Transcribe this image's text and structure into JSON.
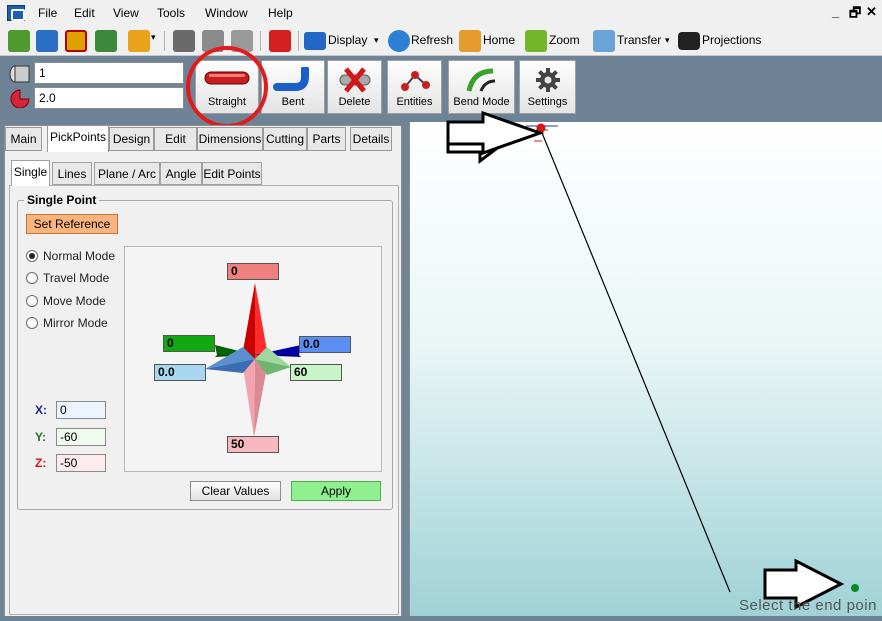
{
  "menu": {
    "items": [
      "File",
      "Edit",
      "View",
      "Tools",
      "Window",
      "Help"
    ],
    "controls": [
      "_",
      "🗗",
      "✕"
    ]
  },
  "toolbar": {
    "display": "Display",
    "refresh": "Refresh",
    "home": "Home",
    "zoom": "Zoom",
    "transfer": "Transfer",
    "projections": "Projections"
  },
  "ribbon": {
    "field1": "1",
    "field2": "2.0",
    "buttons": [
      "Straight",
      "Bent",
      "Delete",
      "Entities",
      "Bend Mode",
      "Settings"
    ]
  },
  "tabs": [
    "Main",
    "PickPoints",
    "Design",
    "Edit",
    "Dimensions",
    "Cutting",
    "Parts",
    "Details"
  ],
  "subtabs": [
    "Single",
    "Lines",
    "Plane / Arc",
    "Angle",
    "Edit Points"
  ],
  "single_point": {
    "title": "Single Point",
    "set_reference": "Set Reference",
    "modes": [
      "Normal Mode",
      "Travel Mode",
      "Move Mode",
      "Mirror Mode"
    ],
    "compass": {
      "top": "0",
      "left_green": "0",
      "right_blue": "0.0",
      "left_lightblue": "0.0",
      "right_lightgreen": "60",
      "bottom": "50"
    },
    "coords": {
      "x_label": "X:",
      "x": "0",
      "y_label": "Y:",
      "y": "-60",
      "z_label": "Z:",
      "z": "-50"
    },
    "clear_values": "Clear Values",
    "apply": "Apply"
  },
  "viewport": {
    "status": "Select the end poin"
  },
  "colors": {
    "accent_red": "#e21a1a",
    "apply_green": "#8ff08f",
    "set_ref_orange": "#fbb47c"
  }
}
